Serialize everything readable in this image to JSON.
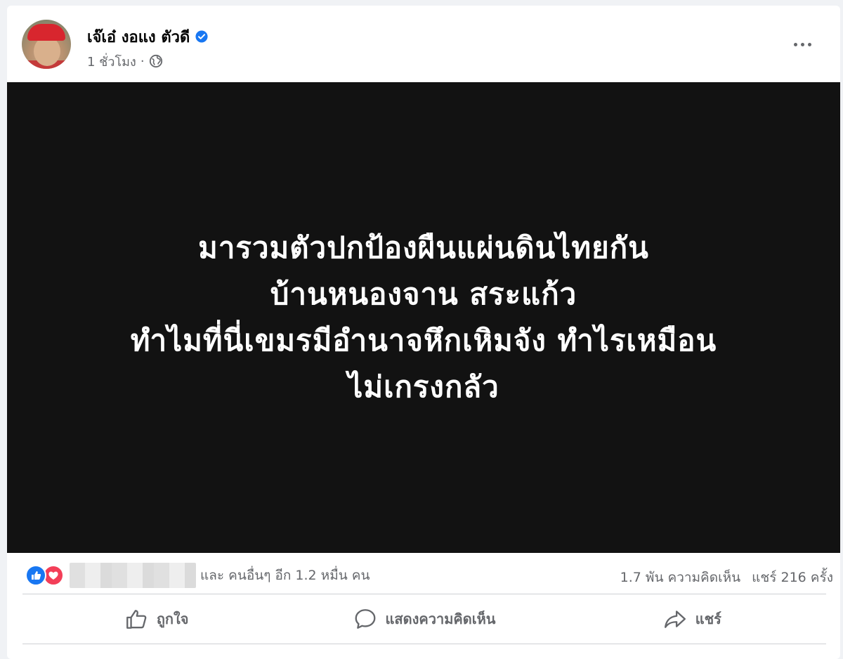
{
  "post": {
    "author_name": "เจ๊เอ๋ งอแง ตัวดี",
    "timestamp": "1 ชั่วโมง",
    "separator": "·",
    "privacy_icon": "globe-icon",
    "image_text_lines": [
      "มารวมตัวปกป้องผืนแผ่นดินไทยกัน",
      "บ้านหนองจาน สระแก้ว",
      "ทำไมที่นี่เขมรมีอำนาจหึกเหิมจัง ทำไรเหมือน",
      "ไม่เกรงกลัว"
    ]
  },
  "stats": {
    "others_text": "และ คนอื่นๆ อีก 1.2 หมื่น คน",
    "comments_text": "1.7 พัน ความคิดเห็น",
    "shares_text": "แชร์ 216 ครั้ง"
  },
  "actions": {
    "like_label": "ถูกใจ",
    "comment_label": "แสดงความคิดเห็น",
    "share_label": "แชร์"
  },
  "colors": {
    "like_blue": "#1877f2",
    "love_red": "#f33e58",
    "image_bg": "#121212",
    "muted_text": "#65676b"
  }
}
